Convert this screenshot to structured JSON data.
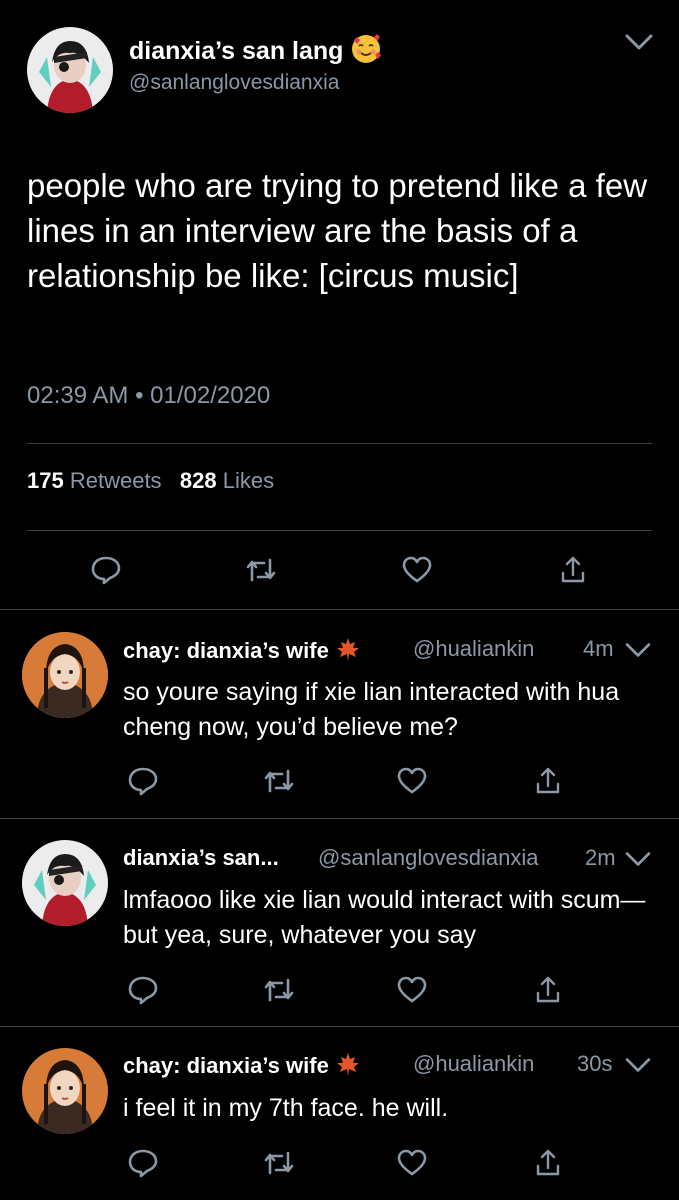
{
  "main_tweet": {
    "display_name": "dianxia’s san lang",
    "name_emoji": "smiling-face-with-hearts",
    "handle": "@sanlanglovesdianxia",
    "text": "people who are trying to pretend like a few lines in an interview are the basis of a relationship be like: [circus music]",
    "time": "02:39 AM",
    "separator": "•",
    "date": "01/02/2020",
    "retweets_count": "175",
    "retweets_label": "Retweets",
    "likes_count": "828",
    "likes_label": "Likes"
  },
  "replies": [
    {
      "display_name": "chay: dianxia’s wife",
      "name_emoji": "maple-leaf",
      "handle": "@hualiankin",
      "time": "4m",
      "text": "so youre saying if xie lian interacted with hua cheng now, you’d believe me?"
    },
    {
      "display_name": "dianxia’s san...",
      "name_emoji": "",
      "handle": "@sanlanglovesdianxia",
      "time": "2m",
      "text": "lmfaooo like xie lian would interact with scum— but yea, sure, whatever you say"
    },
    {
      "display_name": "chay: dianxia’s wife",
      "name_emoji": "maple-leaf",
      "handle": "@hualiankin",
      "time": "30s",
      "text": "i feel it in my 7th face. he will."
    }
  ],
  "colors": {
    "background": "#000000",
    "text_primary": "#ffffff",
    "text_secondary": "#8b98a5",
    "divider": "#3a3f44"
  }
}
